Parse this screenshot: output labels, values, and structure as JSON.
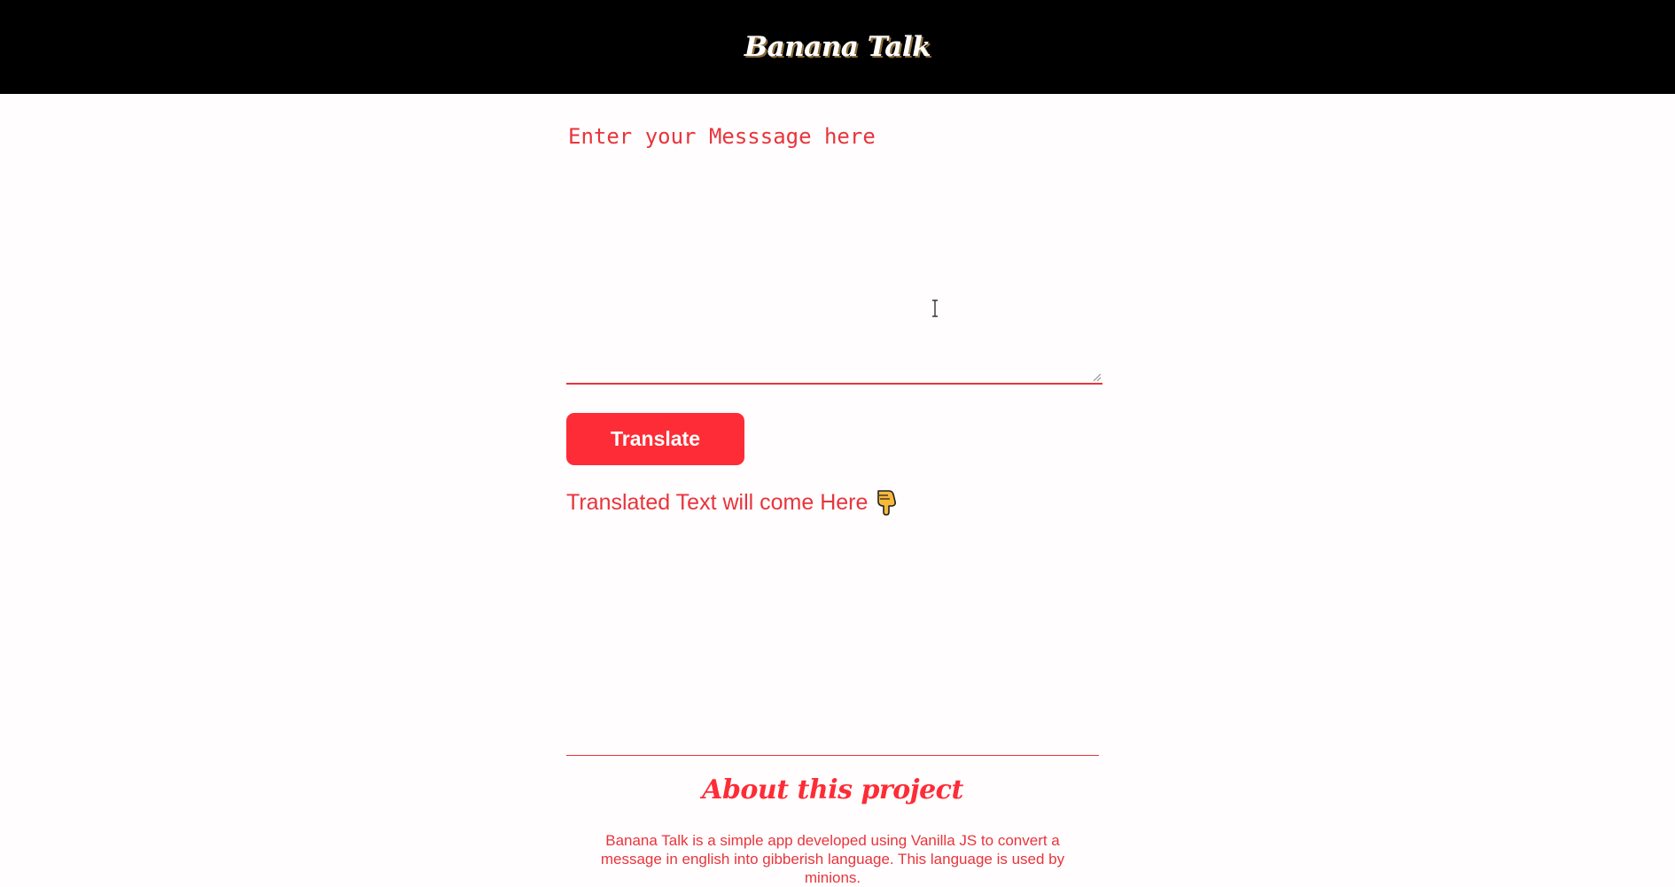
{
  "header": {
    "title": "Banana Talk"
  },
  "input": {
    "placeholder": "Enter your Messsage here"
  },
  "actions": {
    "translate_label": "Translate"
  },
  "output": {
    "label": "Translated Text will come Here",
    "pointer_icon": "pointing-down-icon"
  },
  "about": {
    "title": "About this project",
    "text": "Banana Talk is a simple app developed using Vanilla JS to convert a message in english into gibberish language. This language is used by minions."
  },
  "colors": {
    "accent": "#fe2c36",
    "text": "#e8343c",
    "header_bg": "#000000",
    "page_bg": "#fffdfd"
  }
}
